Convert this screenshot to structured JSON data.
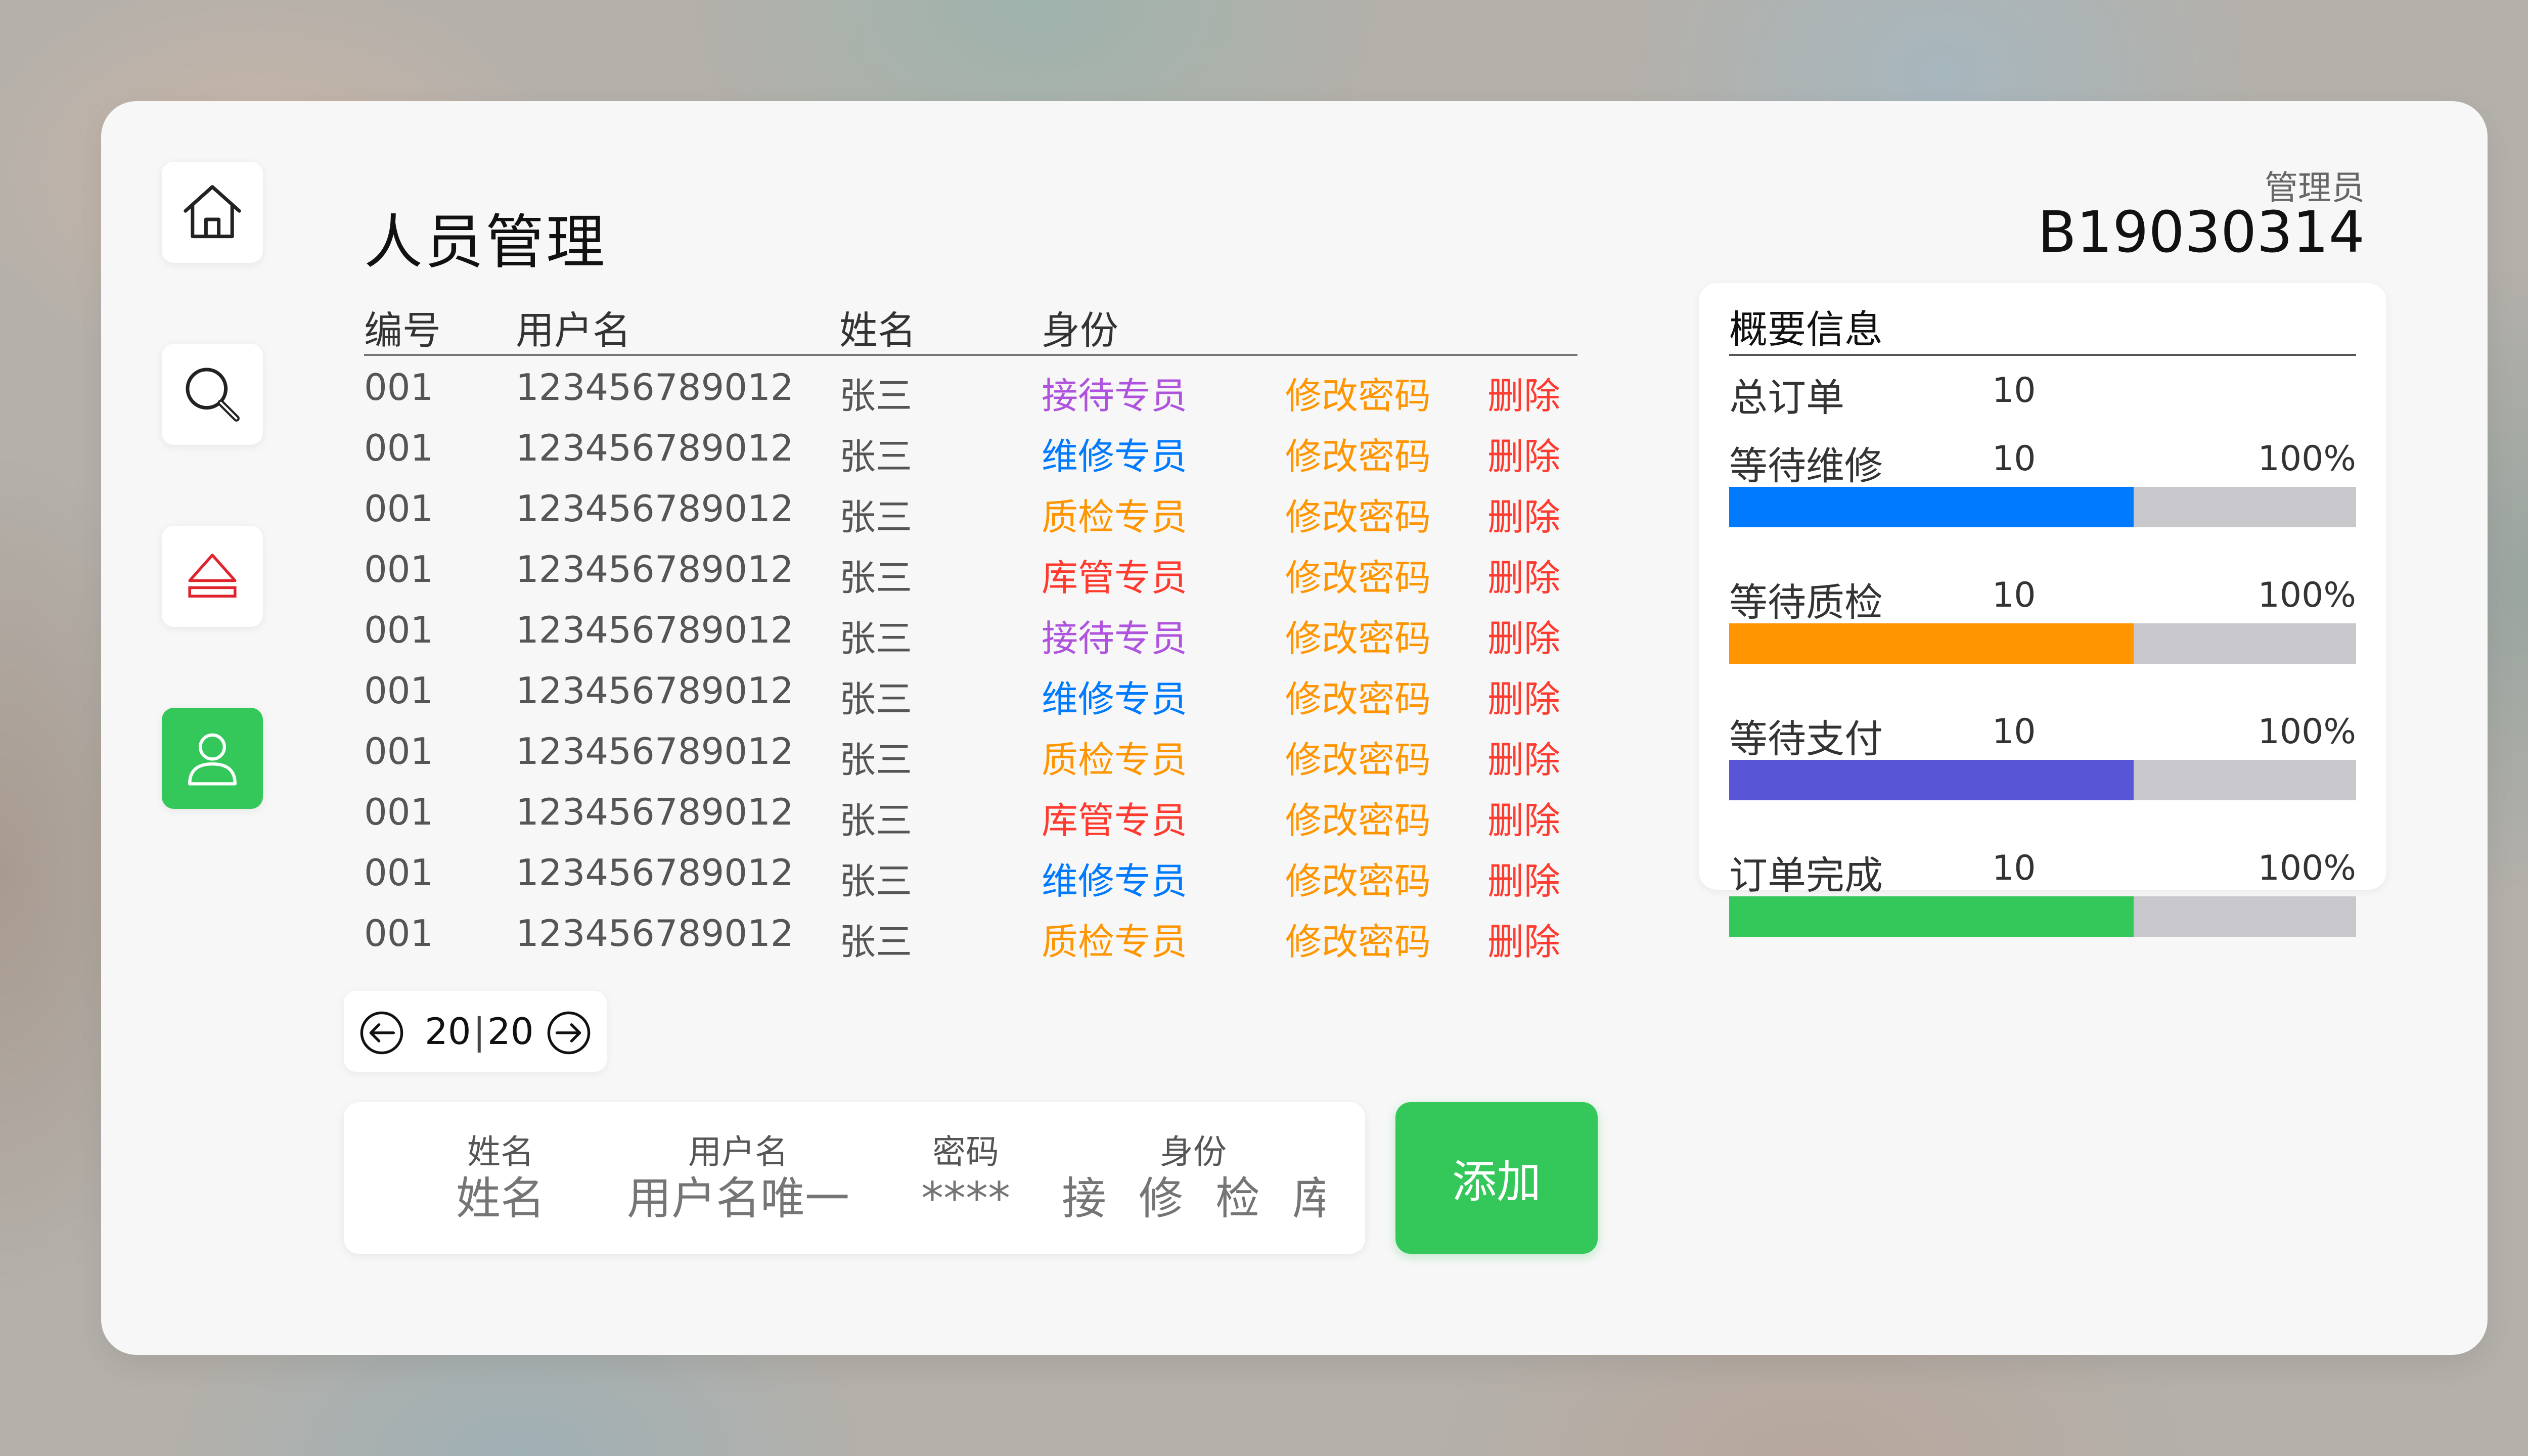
{
  "header": {
    "title": "人员管理",
    "role_label": "管理员",
    "user_id": "B19030314"
  },
  "sidebar": {
    "items": [
      {
        "name": "home",
        "icon": "home-icon",
        "active": false
      },
      {
        "name": "search",
        "icon": "search-icon",
        "active": false
      },
      {
        "name": "eject",
        "icon": "eject-icon",
        "active": false
      },
      {
        "name": "user",
        "icon": "user-icon",
        "active": true
      }
    ]
  },
  "table": {
    "columns": [
      "编号",
      "用户名",
      "姓名",
      "身份"
    ],
    "change_password_label": "修改密码",
    "delete_label": "删除",
    "rows": [
      {
        "id": "001",
        "username": "123456789012",
        "name": "张三",
        "role": "接待专员",
        "role_color": "#af52de"
      },
      {
        "id": "001",
        "username": "123456789012",
        "name": "张三",
        "role": "维修专员",
        "role_color": "#007aff"
      },
      {
        "id": "001",
        "username": "123456789012",
        "name": "张三",
        "role": "质检专员",
        "role_color": "#ff9500"
      },
      {
        "id": "001",
        "username": "123456789012",
        "name": "张三",
        "role": "库管专员",
        "role_color": "#ff3b30"
      },
      {
        "id": "001",
        "username": "123456789012",
        "name": "张三",
        "role": "接待专员",
        "role_color": "#af52de"
      },
      {
        "id": "001",
        "username": "123456789012",
        "name": "张三",
        "role": "维修专员",
        "role_color": "#007aff"
      },
      {
        "id": "001",
        "username": "123456789012",
        "name": "张三",
        "role": "质检专员",
        "role_color": "#ff9500"
      },
      {
        "id": "001",
        "username": "123456789012",
        "name": "张三",
        "role": "库管专员",
        "role_color": "#ff3b30"
      },
      {
        "id": "001",
        "username": "123456789012",
        "name": "张三",
        "role": "维修专员",
        "role_color": "#007aff"
      },
      {
        "id": "001",
        "username": "123456789012",
        "name": "张三",
        "role": "质检专员",
        "role_color": "#ff9500"
      }
    ]
  },
  "pager": {
    "current": "20",
    "separator": "|",
    "total": "20"
  },
  "add_form": {
    "name_label": "姓名",
    "name_placeholder": "姓名",
    "username_label": "用户名",
    "username_placeholder": "用户名唯一",
    "password_label": "密码",
    "password_placeholder": "****",
    "role_label": "身份",
    "role_options_placeholder": "接 修 检 库",
    "add_button": "添加"
  },
  "summary": {
    "title": "概要信息",
    "total_label": "总订单",
    "total_value": "10",
    "items": [
      {
        "label": "等待维修",
        "value": "10",
        "percent": "100%",
        "fill": 0.645,
        "color": "#007aff"
      },
      {
        "label": "等待质检",
        "value": "10",
        "percent": "100%",
        "fill": 0.645,
        "color": "#ff9500"
      },
      {
        "label": "等待支付",
        "value": "10",
        "percent": "100%",
        "fill": 0.645,
        "color": "#5856d6"
      },
      {
        "label": "订单完成",
        "value": "10",
        "percent": "100%",
        "fill": 0.645,
        "color": "#34c759"
      }
    ]
  },
  "colors": {
    "accent_green": "#34c759",
    "change_password": "#ff9500",
    "delete": "#ff3b30"
  }
}
